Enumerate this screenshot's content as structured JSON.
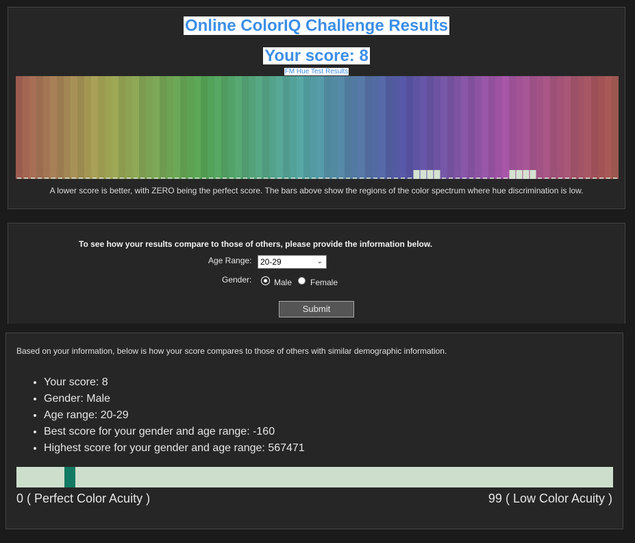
{
  "results": {
    "title": "Online ColorIQ Challenge Results",
    "score_heading": "Your score: 8",
    "subtitle_link": "FM Hue Test Results",
    "caption": "A lower score is better, with ZERO being the perfect score. The bars above show the regions of the color spectrum where hue discrimination is low.",
    "spectrum": {
      "segment_count": 88,
      "error_blocks": [
        58,
        59,
        60,
        61,
        72,
        73,
        74,
        75
      ]
    }
  },
  "form": {
    "intro": "To see how your results compare to those of others, please provide the information below.",
    "age_label": "Age Range:",
    "age_value": "20-29",
    "gender_label": "Gender:",
    "male_label": "Male",
    "female_label": "Female",
    "selected_gender": "Male",
    "submit_label": "Submit"
  },
  "comparison": {
    "intro": "Based on your information, below is how your score compares to those of others with similar demographic information.",
    "items": [
      "Your score: 8",
      "Gender: Male",
      "Age range: 20-29",
      "Best score for your gender and age range: -160",
      "Highest score for your gender and age range: 567471"
    ],
    "bar": {
      "marker_fraction": 0.08,
      "fill_color": "#cddfcc",
      "marker_color": "#127a62"
    },
    "scale_left": "0 ( Perfect Color Acuity )",
    "scale_right": "99 ( Low Color Acuity )"
  }
}
